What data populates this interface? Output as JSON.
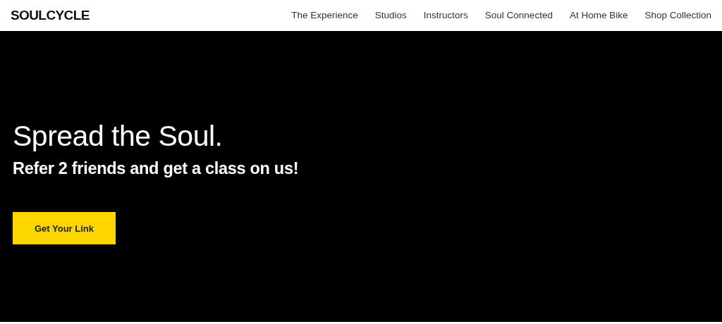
{
  "header": {
    "logo": "SOULCYCLE",
    "nav": [
      {
        "label": "The Experience"
      },
      {
        "label": "Studios"
      },
      {
        "label": "Instructors"
      },
      {
        "label": "Soul Connected"
      },
      {
        "label": "At Home Bike"
      },
      {
        "label": "Shop Collection"
      }
    ]
  },
  "hero": {
    "title": "Spread the Soul.",
    "subtitle": "Refer 2 friends and get a class on us!",
    "button": "Get Your Link"
  }
}
